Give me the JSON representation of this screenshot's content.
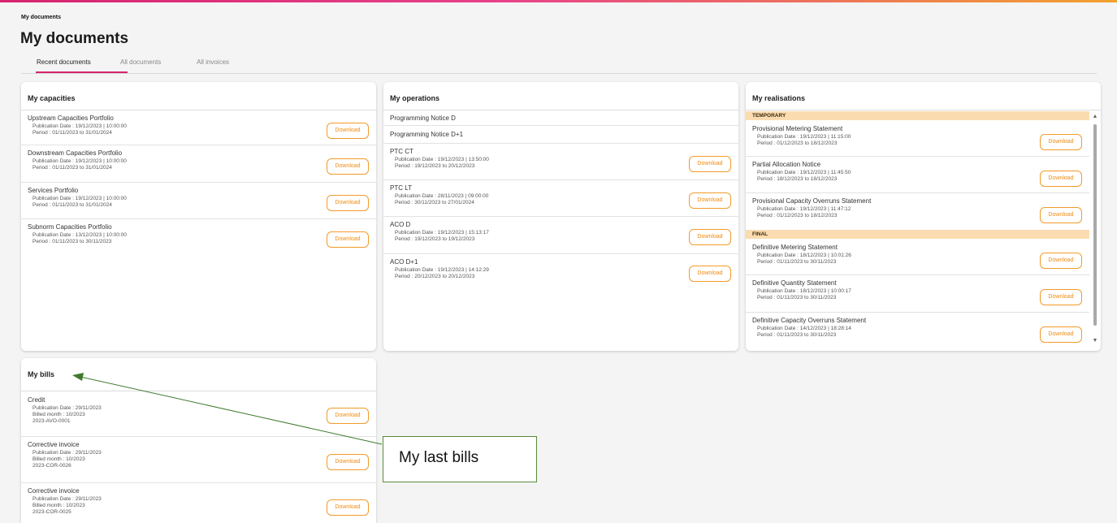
{
  "breadcrumb": "My documents",
  "page_title": "My documents",
  "tabs": [
    {
      "label": "Recent documents",
      "active": true
    },
    {
      "label": "All documents",
      "active": false
    },
    {
      "label": "All invoices",
      "active": false
    }
  ],
  "download_label": "Download",
  "colors": {
    "accent": "#d6246e",
    "download": "#f29b2a",
    "section_band": "#fbdcb0",
    "callout_border": "#5a8a3c"
  },
  "capacities": {
    "title": "My capacities",
    "items": [
      {
        "name": "Upstream Capacities Portfolio",
        "meta": [
          "Publication Date : 19/12/2023 | 10:00:00",
          "Period : 01/11/2023 to 31/01/2024"
        ]
      },
      {
        "name": "Downstream Capacities Portfolio",
        "meta": [
          "Publication Date : 19/12/2023 | 10:00:00",
          "Period : 01/11/2023 to 31/01/2024"
        ]
      },
      {
        "name": "Services Portfolio",
        "meta": [
          "Publication Date : 19/12/2023 | 10:00:00",
          "Period : 01/11/2023 to 31/01/2024"
        ]
      },
      {
        "name": "Subnorm Capacities Portfolio",
        "meta": [
          "Publication Date : 13/12/2023 | 10:00:00",
          "Period : 01/11/2023 to 30/11/2023"
        ]
      }
    ]
  },
  "operations": {
    "title": "My operations",
    "items": [
      {
        "name": "Programming Notice D",
        "meta": []
      },
      {
        "name": "Programming Notice D+1",
        "meta": []
      },
      {
        "name": "PTC CT",
        "meta": [
          "Publication Date : 19/12/2023 | 13:50:00",
          "Period : 19/12/2023 to 20/12/2023"
        ]
      },
      {
        "name": "PTC LT",
        "meta": [
          "Publication Date : 28/11/2023 | 09:00:00",
          "Period : 30/11/2023 to 27/01/2024"
        ]
      },
      {
        "name": "ACO D",
        "meta": [
          "Publication Date : 19/12/2023 | 15:13:17",
          "Period : 19/12/2023 to 19/12/2023"
        ]
      },
      {
        "name": "ACO D+1",
        "meta": [
          "Publication Date : 19/12/2023 | 14:12:29",
          "Period : 20/12/2023 to 20/12/2023"
        ]
      }
    ]
  },
  "realisations": {
    "title": "My realisations",
    "sections": [
      {
        "label": "TEMPORARY",
        "items": [
          {
            "name": "Provisional Metering Statement",
            "meta": [
              "Publication Date : 19/12/2023 | 11:15:00",
              "Period : 01/12/2023 to 18/12/2023"
            ]
          },
          {
            "name": "Partial Allocation Notice",
            "meta": [
              "Publication Date : 19/12/2023 | 11:45:50",
              "Period : 18/12/2023 to 18/12/2023"
            ]
          },
          {
            "name": "Provisional Capacity Overruns Statement",
            "meta": [
              "Publication Date : 19/12/2023 | 11:47:12",
              "Period : 01/12/2023 to 18/12/2023"
            ]
          }
        ]
      },
      {
        "label": "FINAL",
        "items": [
          {
            "name": "Definitive Metering Statement",
            "meta": [
              "Publication Date : 18/12/2023 | 10:01:26",
              "Period : 01/11/2023 to 30/11/2023"
            ]
          },
          {
            "name": "Definitive Quantity Statement",
            "meta": [
              "Publication Date : 18/12/2023 | 10:00:17",
              "Period : 01/11/2023 to 30/11/2023"
            ]
          },
          {
            "name": "Definitive Capacity Overruns Statement",
            "meta": [
              "Publication Date : 14/12/2023 | 18:28:14",
              "Period : 01/11/2023 to 30/11/2023"
            ]
          }
        ]
      }
    ]
  },
  "bills": {
    "title": "My bills",
    "items": [
      {
        "name": "Credit",
        "meta": [
          "Publication Date : 29/11/2023",
          "Billed month : 10/2023",
          "2023-AVO-0001"
        ]
      },
      {
        "name": "Corrective invoice",
        "meta": [
          "Publication Date : 29/11/2023",
          "Billed month : 10/2023",
          "2023-COR-0026"
        ]
      },
      {
        "name": "Corrective invoice",
        "meta": [
          "Publication Date : 29/11/2023",
          "Billed month : 10/2023",
          "2023-COR-0025"
        ]
      }
    ]
  },
  "callout": {
    "text": "My last bills"
  }
}
